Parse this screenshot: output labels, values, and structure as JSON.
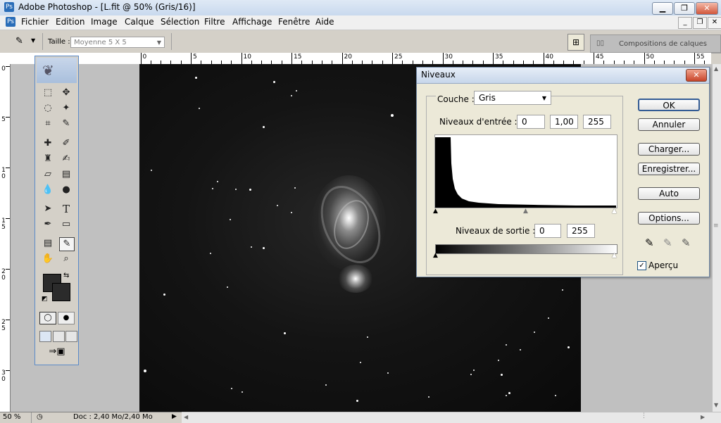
{
  "window": {
    "title": "Adobe Photoshop - [L.fit @ 50% (Gris/16)]",
    "controls": [
      "minimize",
      "restore",
      "close"
    ]
  },
  "menu": {
    "items": [
      "Fichier",
      "Edition",
      "Image",
      "Calque",
      "Sélection",
      "Filtre",
      "Affichage",
      "Fenêtre",
      "Aide"
    ]
  },
  "options_bar": {
    "size_label": "Taille :",
    "size_value": "Moyenne 5 X 5",
    "palette_tab": "Compositions de calques"
  },
  "rulers": {
    "horizontal": [
      "5",
      "0",
      "5",
      "10",
      "15",
      "20",
      "25",
      "30",
      "35",
      "40",
      "45",
      "50",
      "55"
    ],
    "vertical": [
      "0",
      "5",
      "1 0",
      "1 5",
      "2 0",
      "2 5",
      "3 0"
    ]
  },
  "status": {
    "zoom": "50 %",
    "doc": "Doc : 2,40 Mo/2,40 Mo"
  },
  "dialog": {
    "title": "Niveaux",
    "channel_label": "Couche :",
    "channel_value": "Gris",
    "input_levels_label": "Niveaux d'entrée :",
    "input_levels": [
      "0",
      "1,00",
      "255"
    ],
    "output_levels_label": "Niveaux de sortie :",
    "output_levels": [
      "0",
      "255"
    ],
    "buttons": {
      "ok": "OK",
      "cancel": "Annuler",
      "load": "Charger...",
      "save": "Enregistrer...",
      "auto": "Auto",
      "options": "Options..."
    },
    "preview_label": "Aperçu",
    "preview_checked": true
  },
  "colors": {
    "foreground": "#2b2b2b",
    "background": "#2b2b2b",
    "image_bg": "#111111"
  }
}
